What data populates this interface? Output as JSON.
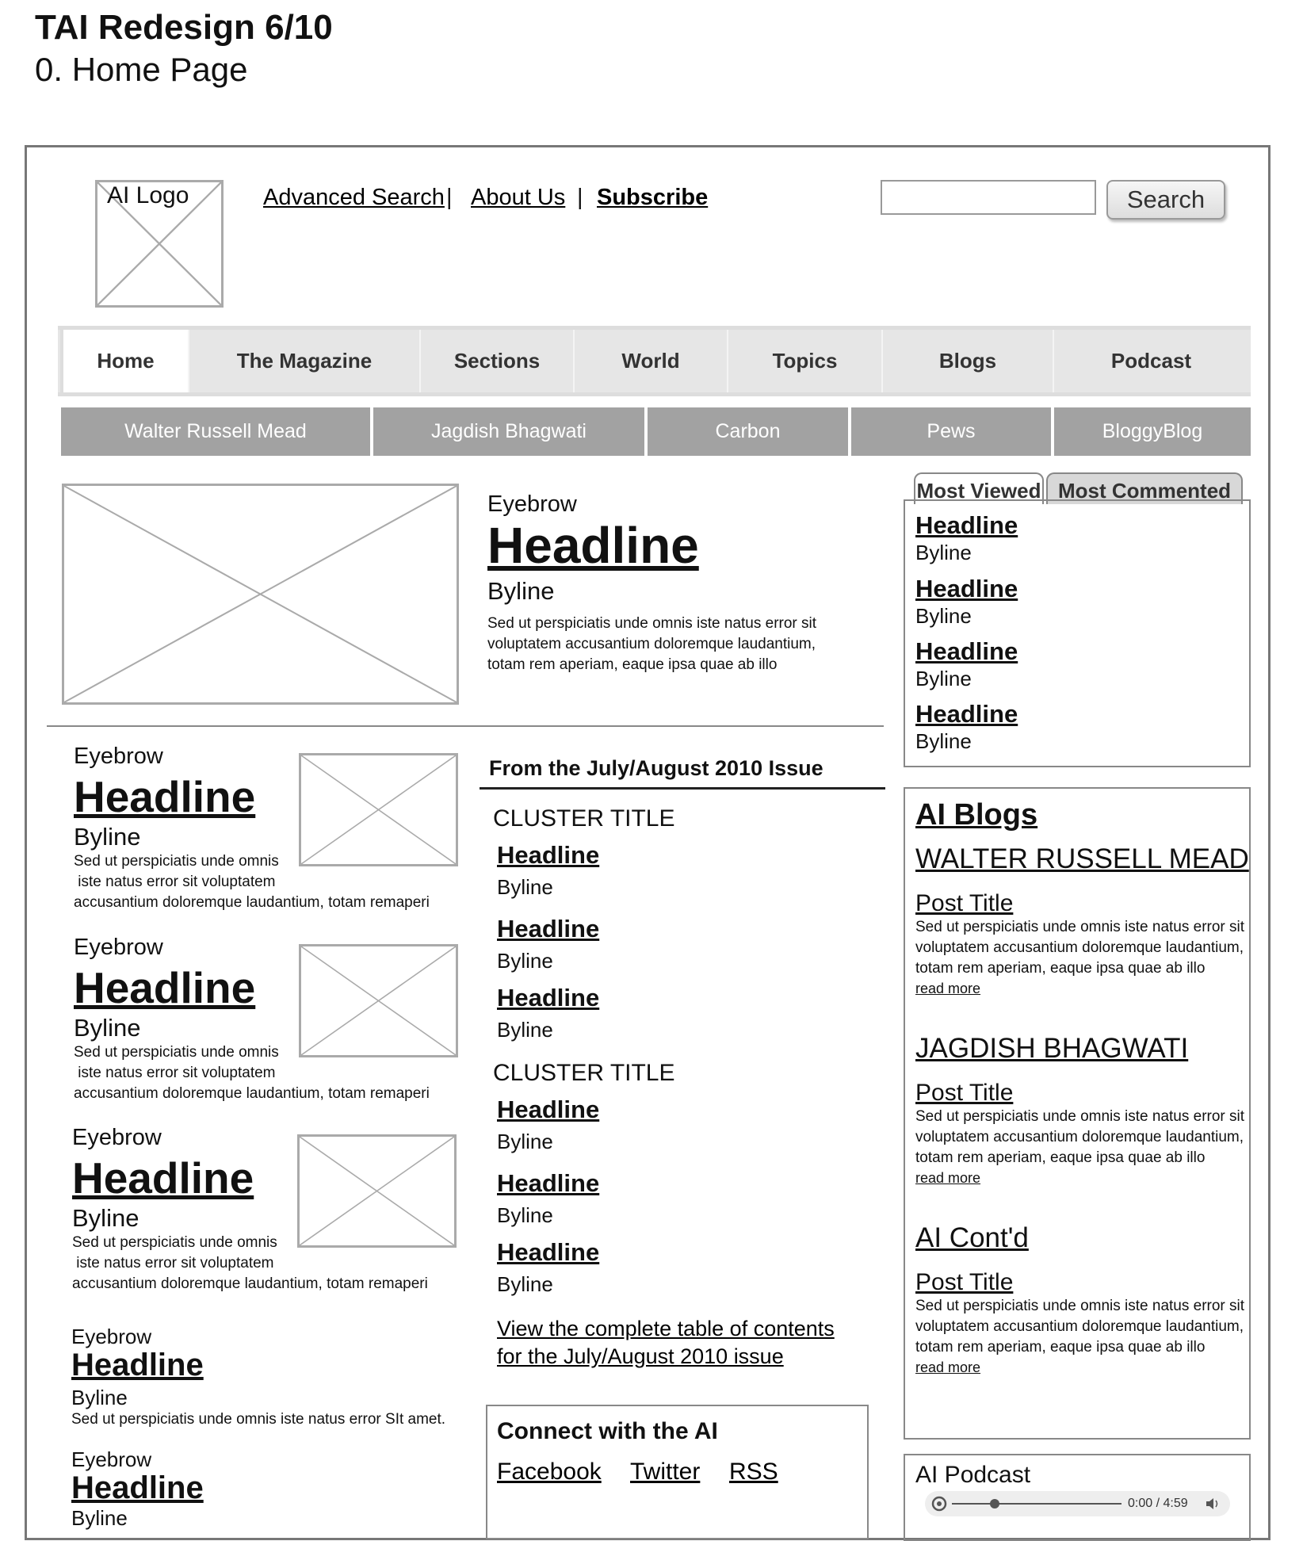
{
  "doc": {
    "title": "TAI Redesign 6/10",
    "subtitle": "0. Home Page"
  },
  "header": {
    "logo_label": "AI Logo",
    "links": [
      "Advanced Search",
      "About Us",
      "Subscribe"
    ],
    "separator": "|",
    "search_button": "Search",
    "search_value": ""
  },
  "nav": {
    "tabs": [
      "Home",
      "The Magazine",
      "Sections",
      "World",
      "Topics",
      "Blogs",
      "Podcast"
    ],
    "subtabs": [
      "Walter Russell Mead",
      "Jagdish Bhagwati",
      "Carbon",
      "Pews",
      "BloggyBlog"
    ]
  },
  "lead": {
    "eyebrow": "Eyebrow",
    "headline": "Headline",
    "byline": "Byline",
    "body": "Sed ut perspiciatis unde omnis iste natus error sit voluptatem accusantium doloremque laudantium, totam rem aperiam, eaque ipsa quae ab illo"
  },
  "features": [
    {
      "eyebrow": "Eyebrow",
      "headline": "Headline",
      "byline": "Byline",
      "body": [
        "Sed ut perspiciatis unde omnis",
        " iste natus error sit voluptatem",
        "accusantium doloremque laudantium, totam remaperi"
      ]
    },
    {
      "eyebrow": "Eyebrow",
      "headline": "Headline",
      "byline": "Byline",
      "body": [
        "Sed ut perspiciatis unde omnis",
        " iste natus error sit voluptatem",
        "accusantium doloremque laudantium, totam remaperi"
      ]
    },
    {
      "eyebrow": "Eyebrow",
      "headline": "Headline",
      "byline": "Byline",
      "body": [
        "Sed ut perspiciatis unde omnis",
        " iste natus error sit voluptatem",
        "accusantium doloremque laudantium, totam remaperi"
      ]
    }
  ],
  "small_stories": [
    {
      "eyebrow": "Eyebrow",
      "headline": "Headline",
      "byline": "Byline",
      "body": "Sed ut perspiciatis unde omnis iste natus error SIt amet."
    },
    {
      "eyebrow": "Eyebrow",
      "headline": "Headline",
      "byline": "Byline"
    }
  ],
  "issue": {
    "heading": "From the July/August 2010 Issue",
    "clusters": [
      {
        "title": "CLUSTER TITLE",
        "items": [
          {
            "headline": "Headline",
            "byline": "Byline"
          },
          {
            "headline": "Headline",
            "byline": "Byline"
          },
          {
            "headline": "Headline",
            "byline": "Byline"
          }
        ]
      },
      {
        "title": "CLUSTER TITLE",
        "items": [
          {
            "headline": "Headline",
            "byline": "Byline"
          },
          {
            "headline": "Headline",
            "byline": "Byline"
          },
          {
            "headline": "Headline",
            "byline": "Byline"
          }
        ]
      }
    ],
    "toc_link": [
      "View the complete table of contents",
      "for the July/August 2010 issue"
    ]
  },
  "connect": {
    "title": "Connect with the AI",
    "links": [
      "Facebook",
      "Twitter",
      "RSS"
    ]
  },
  "popular": {
    "tabs": [
      "Most Viewed",
      "Most Commented"
    ],
    "items": [
      {
        "headline": "Headline",
        "byline": "Byline"
      },
      {
        "headline": "Headline",
        "byline": "Byline"
      },
      {
        "headline": "Headline",
        "byline": "Byline"
      },
      {
        "headline": "Headline",
        "byline": "Byline"
      }
    ]
  },
  "blogs": {
    "title": "AI Blogs",
    "entries": [
      {
        "author": "WALTER RUSSELL MEAD",
        "post_title": "Post Title",
        "body": [
          "Sed ut perspiciatis unde omnis iste natus error sit",
          "voluptatem accusantium doloremque laudantium,",
          "totam rem aperiam, eaque ipsa quae ab illo"
        ],
        "read_more": "read more"
      },
      {
        "author": "JAGDISH BHAGWATI",
        "post_title": "Post Title",
        "body": [
          "Sed ut perspiciatis unde omnis iste natus error sit",
          "voluptatem accusantium doloremque laudantium,",
          "totam rem aperiam, eaque ipsa quae ab illo"
        ],
        "read_more": "read more"
      },
      {
        "author": "AI Cont'd",
        "post_title": "Post Title",
        "body": [
          "Sed ut perspiciatis unde omnis iste natus error sit",
          "voluptatem accusantium doloremque laudantium,",
          "totam rem aperiam, eaque ipsa quae ab illo"
        ],
        "read_more": "read more"
      }
    ]
  },
  "podcast": {
    "title": "AI Podcast",
    "time": "0:00 / 4:59",
    "progress": 0.25
  }
}
